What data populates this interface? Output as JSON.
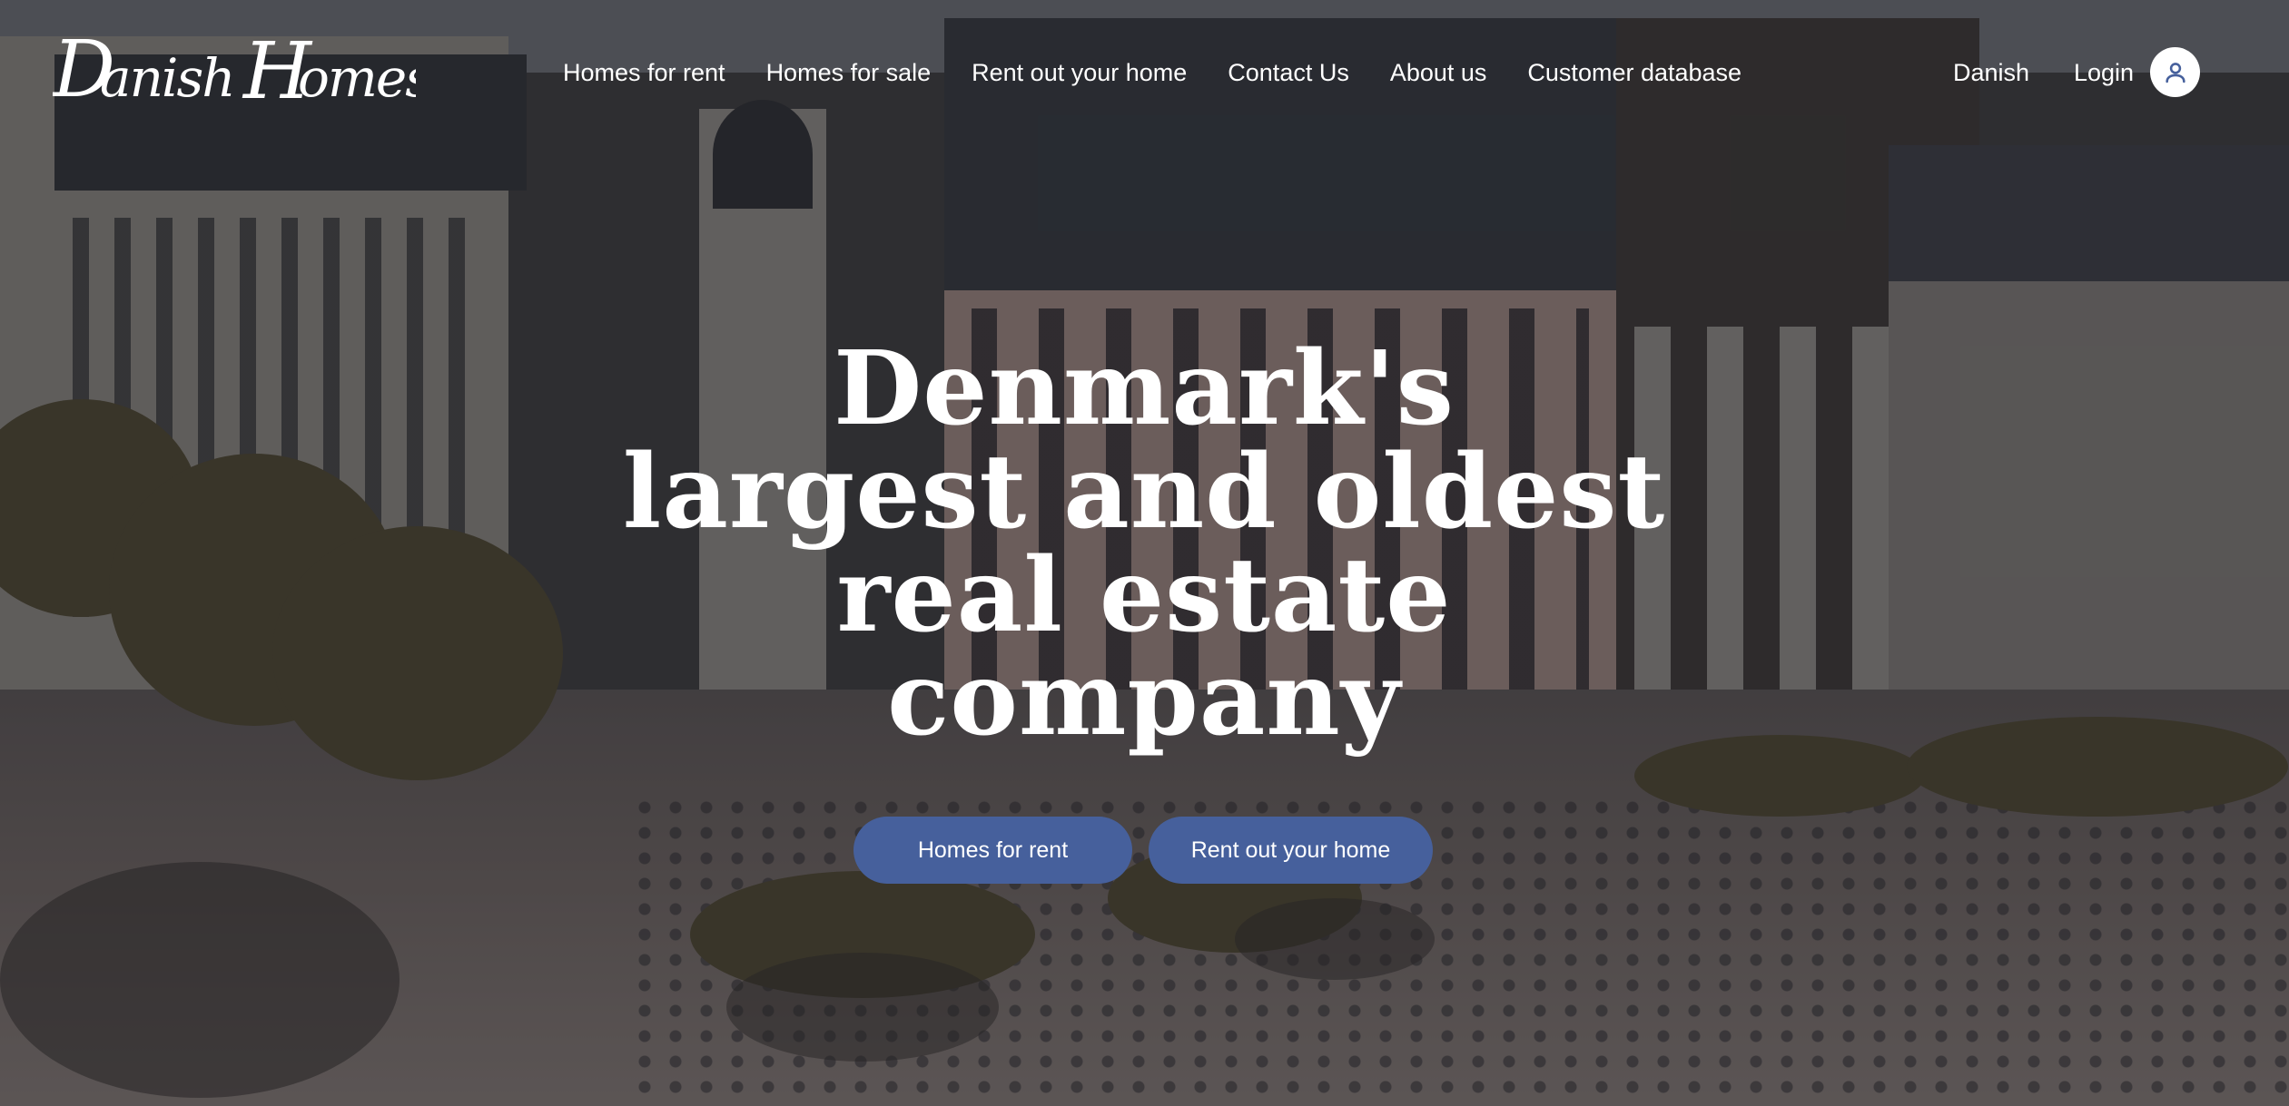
{
  "brand": {
    "logo_text": "Danish Homes"
  },
  "nav": {
    "items": [
      {
        "label": "Homes for rent"
      },
      {
        "label": "Homes for sale"
      },
      {
        "label": "Rent out your home"
      },
      {
        "label": "Contact Us"
      },
      {
        "label": "About us"
      },
      {
        "label": "Customer database"
      }
    ],
    "language": "Danish",
    "login": "Login"
  },
  "hero": {
    "title_lines": [
      "Denmark's",
      "largest and oldest",
      "real estate",
      "company"
    ],
    "buttons": {
      "primary": "Homes for rent",
      "secondary": "Rent out your home"
    }
  },
  "icons": {
    "account": "user-icon"
  },
  "colors": {
    "button_bg": "#46609c",
    "text": "#ffffff"
  }
}
